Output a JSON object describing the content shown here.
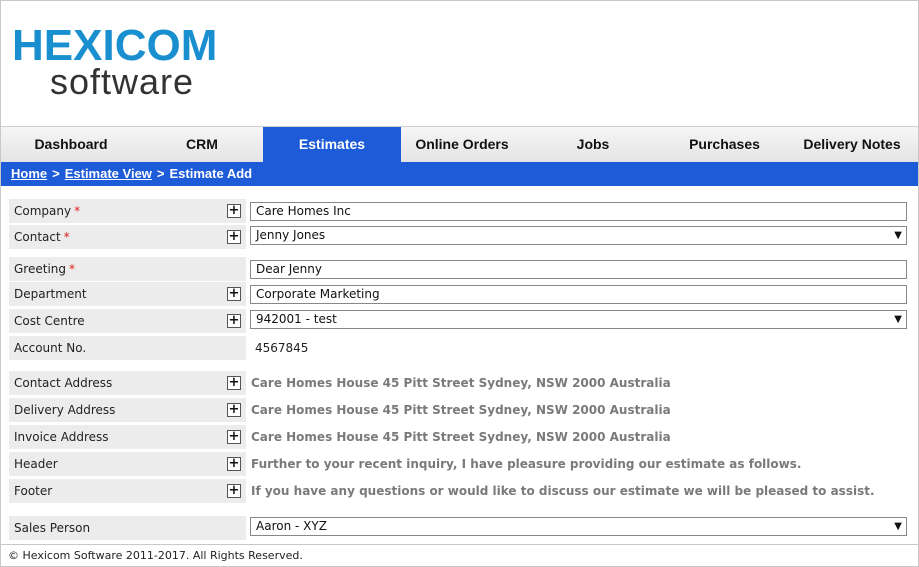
{
  "logo": {
    "brand": "HEXICOM",
    "sub": "software"
  },
  "nav": {
    "items": [
      {
        "label": "Dashboard"
      },
      {
        "label": "CRM"
      },
      {
        "label": "Estimates"
      },
      {
        "label": "Online Orders"
      },
      {
        "label": "Jobs"
      },
      {
        "label": "Purchases"
      },
      {
        "label": "Delivery Notes"
      }
    ],
    "active": "Estimates",
    "active_color": "#1e5bd8"
  },
  "breadcrumb": {
    "home": "Home",
    "sep1": ">",
    "estimate_view": "Estimate View",
    "sep2": ">",
    "current": "Estimate Add"
  },
  "form": {
    "company": {
      "label": "Company",
      "required": "*",
      "value": "Care Homes Inc"
    },
    "contact": {
      "label": "Contact",
      "required": "*",
      "value": "Jenny Jones"
    },
    "greeting": {
      "label": "Greeting",
      "required": "*",
      "value": "Dear Jenny"
    },
    "department": {
      "label": "Department",
      "value": "Corporate Marketing"
    },
    "cost_centre": {
      "label": "Cost Centre",
      "value": "942001 - test"
    },
    "account_no": {
      "label": "Account No.",
      "value": "4567845"
    },
    "contact_address": {
      "label": "Contact Address",
      "value": "Care Homes House 45 Pitt Street Sydney, NSW 2000 Australia"
    },
    "delivery_address": {
      "label": "Delivery Address",
      "value": "Care Homes House 45 Pitt Street Sydney, NSW 2000 Australia"
    },
    "invoice_address": {
      "label": "Invoice Address",
      "value": "Care Homes House 45 Pitt Street Sydney, NSW 2000 Australia"
    },
    "header": {
      "label": "Header",
      "value": "Further to your recent inquiry, I have pleasure providing our estimate as follows."
    },
    "footer": {
      "label": "Footer",
      "value": "If you have any questions or would like to discuss our estimate we will be pleased to assist."
    },
    "sales_person": {
      "label": "Sales Person",
      "value": "Aaron - XYZ"
    }
  },
  "icons": {
    "plus": "+",
    "dropdown": "▼"
  },
  "footer": {
    "copyright": "© Hexicom Software 2011-2017. All Rights Reserved."
  }
}
